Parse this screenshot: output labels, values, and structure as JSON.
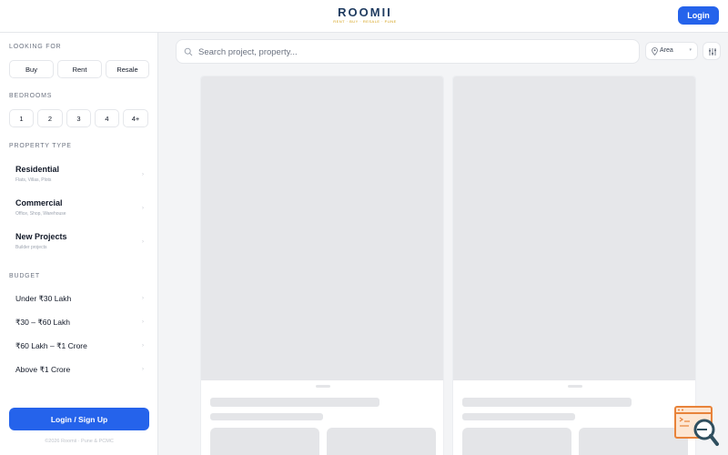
{
  "header": {
    "logo_text": "ROOMII",
    "logo_tagline": "RENT · BUY · RESALE · PUNE",
    "login_label": "Login"
  },
  "sidebar": {
    "looking_for": {
      "title": "LOOKING FOR",
      "options": [
        "Buy",
        "Rent",
        "Resale"
      ]
    },
    "bedrooms": {
      "title": "BEDROOMS",
      "options": [
        "1",
        "2",
        "3",
        "4",
        "4+"
      ]
    },
    "property_type": {
      "title": "PROPERTY TYPE",
      "items": [
        {
          "label": "Residential",
          "sub": "Flats, Villas, Plots"
        },
        {
          "label": "Commercial",
          "sub": "Office, Shop, Warehouse"
        },
        {
          "label": "New Projects",
          "sub": "Builder projects"
        }
      ]
    },
    "budget": {
      "title": "BUDGET",
      "items": [
        "Under ₹30 Lakh",
        "₹30 – ₹60 Lakh",
        "₹60 Lakh – ₹1 Crore",
        "Above ₹1 Crore"
      ]
    },
    "signup_label": "Login / Sign Up",
    "copyright": "©2026 Roomii · Pune & PCMC"
  },
  "search": {
    "placeholder": "Search project, property...",
    "area_label": "Area"
  },
  "colors": {
    "primary": "#2563eb",
    "logo": "#1e3a5f",
    "skeleton": "#e4e5e8"
  }
}
